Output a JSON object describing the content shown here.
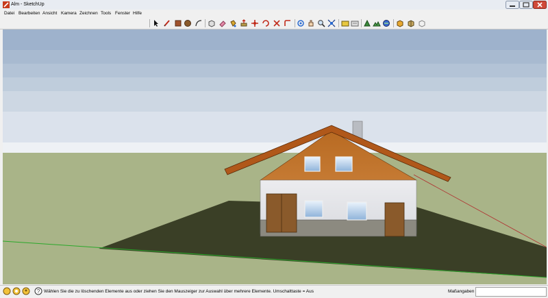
{
  "window": {
    "title": "Alm - SketchUp"
  },
  "menu": {
    "items": [
      "Datei",
      "Bearbeiten",
      "Ansicht",
      "Kamera",
      "Zeichnen",
      "Tools",
      "Fenster",
      "Hilfe"
    ]
  },
  "toolbar": {
    "tools": [
      "select-icon",
      "pencil-icon",
      "rectangle-icon",
      "circle-icon",
      "arc-icon",
      "make-component-icon",
      "eraser-icon",
      "paint-bucket-icon",
      "push-pull-icon",
      "move-icon",
      "rotate-icon",
      "scale-icon",
      "offset-icon",
      "orbit-icon",
      "pan-icon",
      "zoom-icon",
      "zoom-extents-icon",
      "get-models-icon",
      "share-model-icon",
      "google-earth-icon",
      "toggle-terrain-icon",
      "place-model-icon",
      "get-current-view-icon",
      "component-icon",
      "3d-warehouse-icon",
      "share-component-icon"
    ]
  },
  "status": {
    "hint": "Wählen Sie die zu löschenden Elemente aus oder ziehen Sie den Mauszeiger zur Auswahl über mehrere Elemente. Umschalttaste = Aus",
    "measurements_label": "Maßangaben",
    "measurements_value": ""
  },
  "colors": {
    "sky_top": "#9fb3cc",
    "sky_bottom": "#e3e9f0",
    "ground": "#a9b488",
    "terrain": "#3a3f27",
    "roof": "#b5651d",
    "wall": "#e6e8ec",
    "door": "#8a5a2b"
  }
}
